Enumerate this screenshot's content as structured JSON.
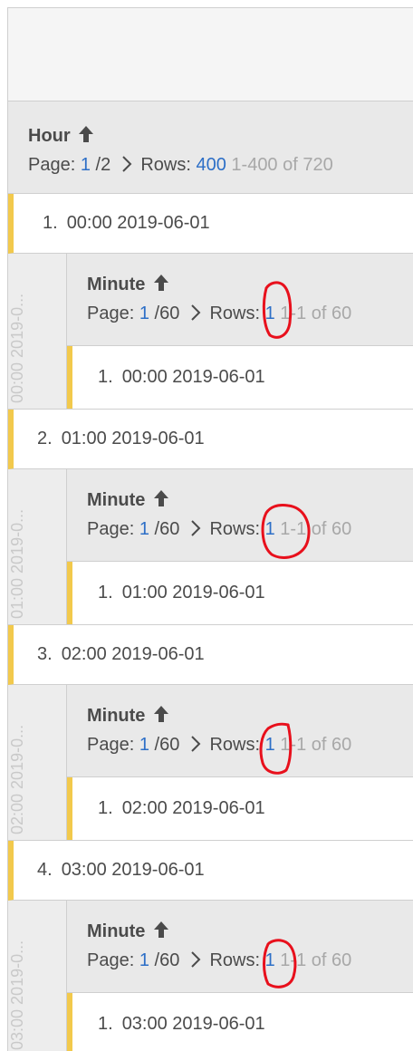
{
  "table": {
    "hour_header": {
      "title": "Hour",
      "page_label": "Page:",
      "page_current": "1",
      "page_total": "/2",
      "rows_label": "Rows:",
      "rows_value": "400",
      "range_text": "1-400 of 720"
    },
    "rows": [
      {
        "number": "1.",
        "value": "00:00 2019-06-01",
        "side_label": "00:00 2019-0...",
        "sub_header": {
          "title": "Minute",
          "page_label": "Page:",
          "page_current": "1",
          "page_total": "/60",
          "rows_label": "Rows:",
          "rows_value": "1",
          "range_text": "1-1 of 60"
        },
        "sub_row": {
          "number": "1.",
          "value": "00:00 2019-06-01"
        }
      },
      {
        "number": "2.",
        "value": "01:00 2019-06-01",
        "side_label": "01:00 2019-0...",
        "sub_header": {
          "title": "Minute",
          "page_label": "Page:",
          "page_current": "1",
          "page_total": "/60",
          "rows_label": "Rows:",
          "rows_value": "1",
          "range_text": "1-1 of 60"
        },
        "sub_row": {
          "number": "1.",
          "value": "01:00 2019-06-01"
        }
      },
      {
        "number": "3.",
        "value": "02:00 2019-06-01",
        "side_label": "02:00 2019-0...",
        "sub_header": {
          "title": "Minute",
          "page_label": "Page:",
          "page_current": "1",
          "page_total": "/60",
          "rows_label": "Rows:",
          "rows_value": "1",
          "range_text": "1-1 of 60"
        },
        "sub_row": {
          "number": "1.",
          "value": "02:00 2019-06-01"
        }
      },
      {
        "number": "4.",
        "value": "03:00 2019-06-01",
        "side_label": "03:00 2019-0...",
        "sub_header": {
          "title": "Minute",
          "page_label": "Page:",
          "page_current": "1",
          "page_total": "/60",
          "rows_label": "Rows:",
          "rows_value": "1",
          "range_text": "1-1 of 60"
        },
        "sub_row": {
          "number": "1.",
          "value": "03:00 2019-06-01"
        }
      }
    ]
  },
  "icons": {
    "sort": "arrow-up-icon",
    "next_page": "chevron-right-icon"
  },
  "colors": {
    "accent_blue": "#2d6fc7",
    "row_marker": "#f2c94c",
    "annotation_red": "#e8101c",
    "header_bg": "#e9e9e9",
    "muted_text": "#a8a8a8"
  }
}
